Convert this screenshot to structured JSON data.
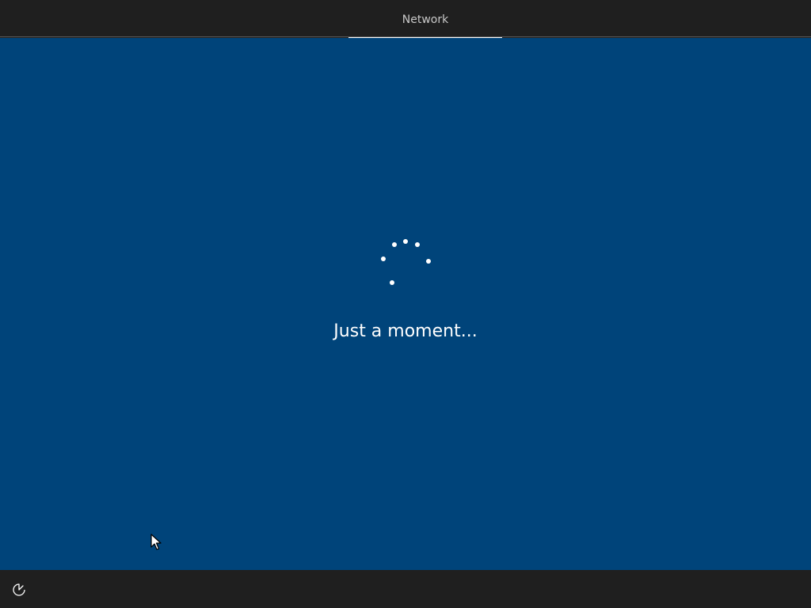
{
  "header": {
    "section_label": "Network"
  },
  "main": {
    "status_text": "Just a moment..."
  },
  "icons": {
    "spinner": "loading-spinner-icon",
    "cursor": "mouse-pointer-icon",
    "accessibility": "ease-of-access-icon"
  },
  "colors": {
    "chrome": "#1f1f1f",
    "panel": "#00447a",
    "text": "#ffffff",
    "tab_label": "#c8c8c8"
  }
}
